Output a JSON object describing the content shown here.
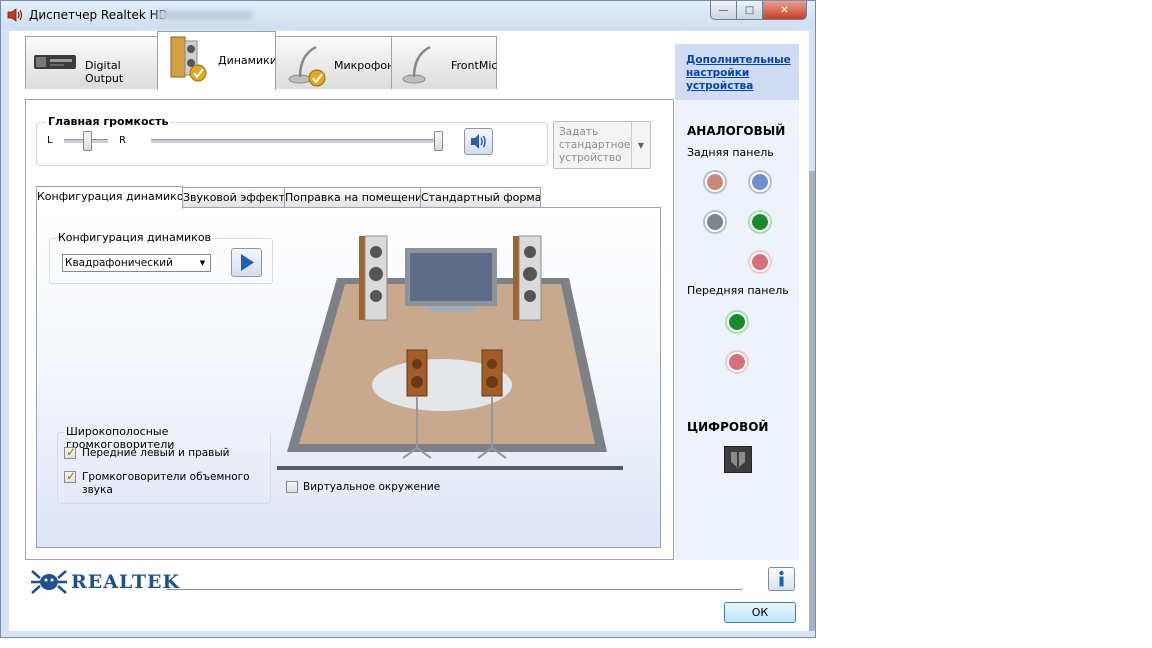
{
  "window": {
    "title": "Диспетчер Realtek HD"
  },
  "device_tabs": [
    {
      "label": "Digital Output"
    },
    {
      "label": "Динамики"
    },
    {
      "label": "Микрофон"
    },
    {
      "label": "FrontMic"
    }
  ],
  "volume": {
    "title": "Главная громкость",
    "left": "L",
    "right": "R",
    "balance_percent": 50,
    "level_percent": 100
  },
  "set_default": {
    "label": "Задать стандартное устройство"
  },
  "sub_tabs": [
    {
      "label": "Конфигурация динамиков"
    },
    {
      "label": "Звуковой эффект"
    },
    {
      "label": "Поправка на помещение"
    },
    {
      "label": "Стандартный формат"
    }
  ],
  "speaker_config": {
    "group_title": "Конфигурация динамиков",
    "selected": "Квадрафонический",
    "wide_group_title": "Широкополосные громкоговорители",
    "front_lr": {
      "label": "Передние левый и правый",
      "checked": true
    },
    "surround": {
      "label": "Громкоговорители объемного звука",
      "checked": true
    },
    "virtual_surround": {
      "label": "Виртуальное окружение",
      "checked": false
    }
  },
  "side_panel": {
    "advanced_link": "Дополнительные настройки устройства",
    "analog_heading": "АНАЛОГОВЫЙ",
    "rear_panel": "Задняя панель",
    "front_panel": "Передняя панель",
    "digital_heading": "ЦИФРОВОЙ",
    "jack_colors": {
      "orange": "#c98a78",
      "blue": "#6f8fce",
      "grey": "#7c8590",
      "green": "#1b8a2a",
      "pink": "#d6707c"
    }
  },
  "footer": {
    "brand": "REALTEK",
    "ok_label": "ОК"
  }
}
